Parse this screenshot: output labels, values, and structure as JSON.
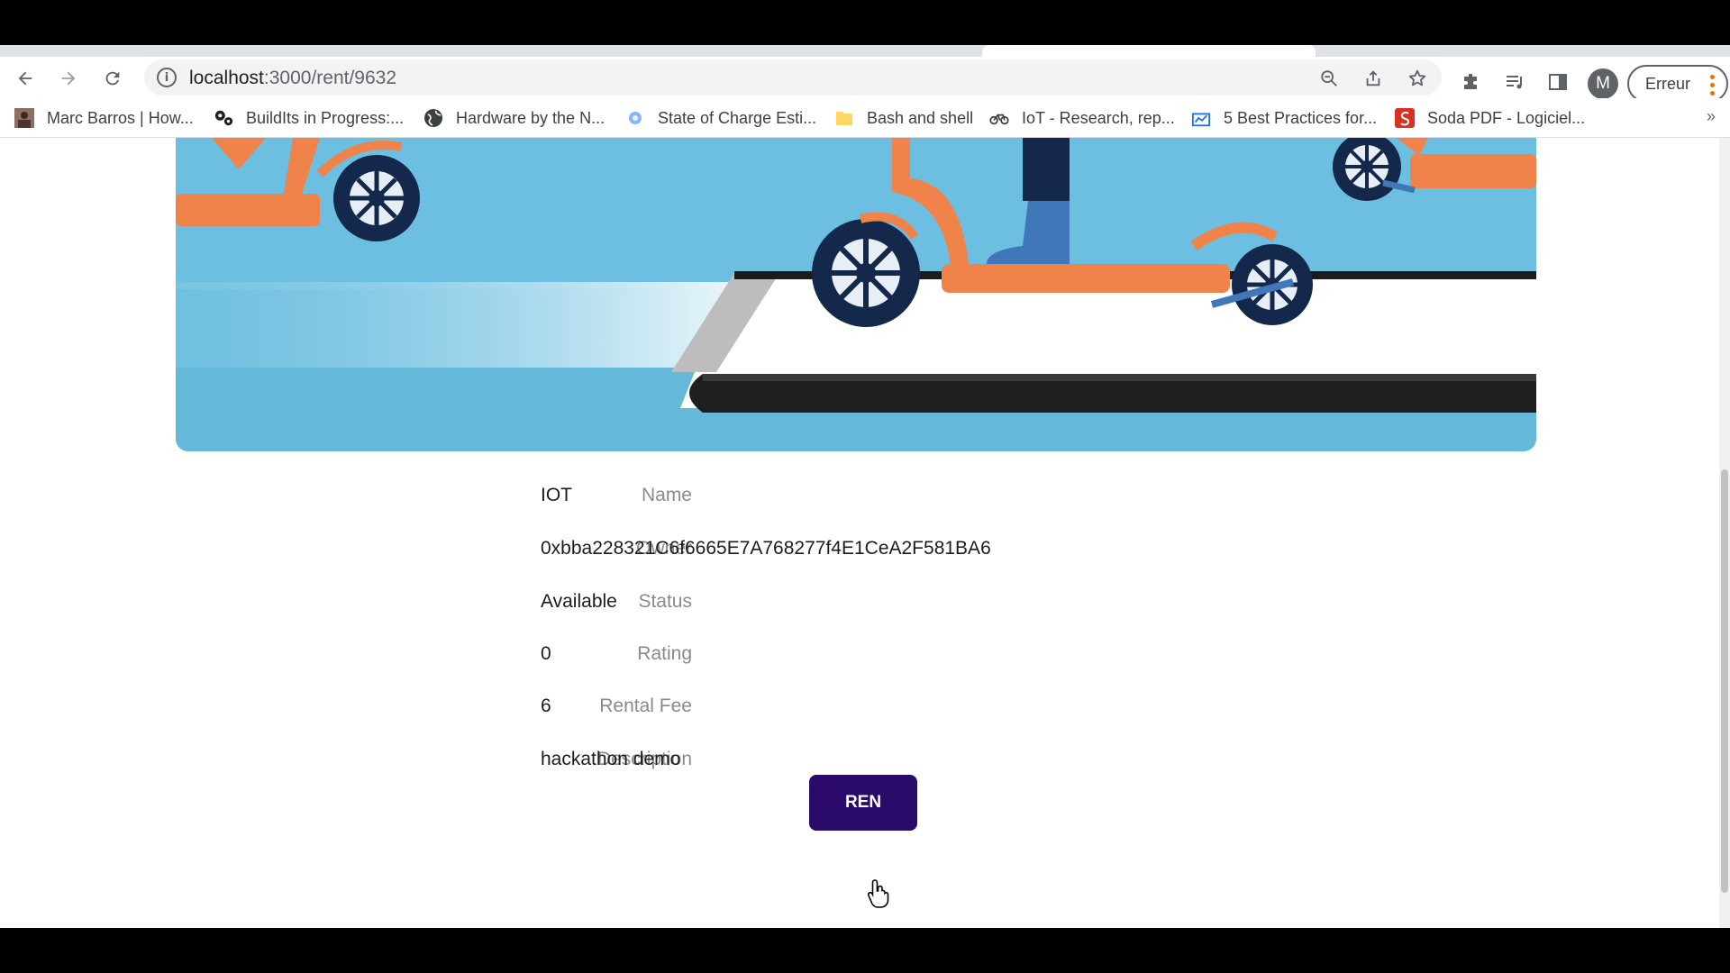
{
  "browser": {
    "url_host": "localhost",
    "url_path": ":3000/rent/9632",
    "account_initial": "M",
    "error_label": "Erreur",
    "bookmarks": [
      {
        "label": "Marc Barros | How...",
        "icon": "person-avatar-icon"
      },
      {
        "label": "BuildIts in Progress:...",
        "icon": "gears-icon"
      },
      {
        "label": "Hardware by the N...",
        "icon": "globe-icon"
      },
      {
        "label": "State of Charge Esti...",
        "icon": "app-icon"
      },
      {
        "label": "Bash and shell",
        "icon": "folder-icon"
      },
      {
        "label": "IoT - Research, rep...",
        "icon": "bike-icon"
      },
      {
        "label": "5 Best Practices for...",
        "icon": "chart-icon"
      },
      {
        "label": "Soda PDF - Logiciel...",
        "icon": "soda-pdf-icon"
      }
    ],
    "bookmarks_more": "»"
  },
  "details": {
    "name": {
      "label": "Name",
      "value": "IOT"
    },
    "owner": {
      "label": "Owner",
      "value": "0xbba228321C6f6665E7A768277f4E1CeA2F581BA6"
    },
    "status": {
      "label": "Status",
      "value": "Available"
    },
    "rating": {
      "label": "Rating",
      "value": "0"
    },
    "rental_fee": {
      "label": "Rental Fee",
      "value": "6"
    },
    "description": {
      "label": "Description",
      "value": "hackathon demo"
    }
  },
  "rent_button": {
    "label": "REN"
  },
  "colors": {
    "hero_sky": "#6cbfe0",
    "scooter_orange": "#f0834a",
    "wheel_navy": "#13284a",
    "button_purple": "#2a0a6b"
  }
}
